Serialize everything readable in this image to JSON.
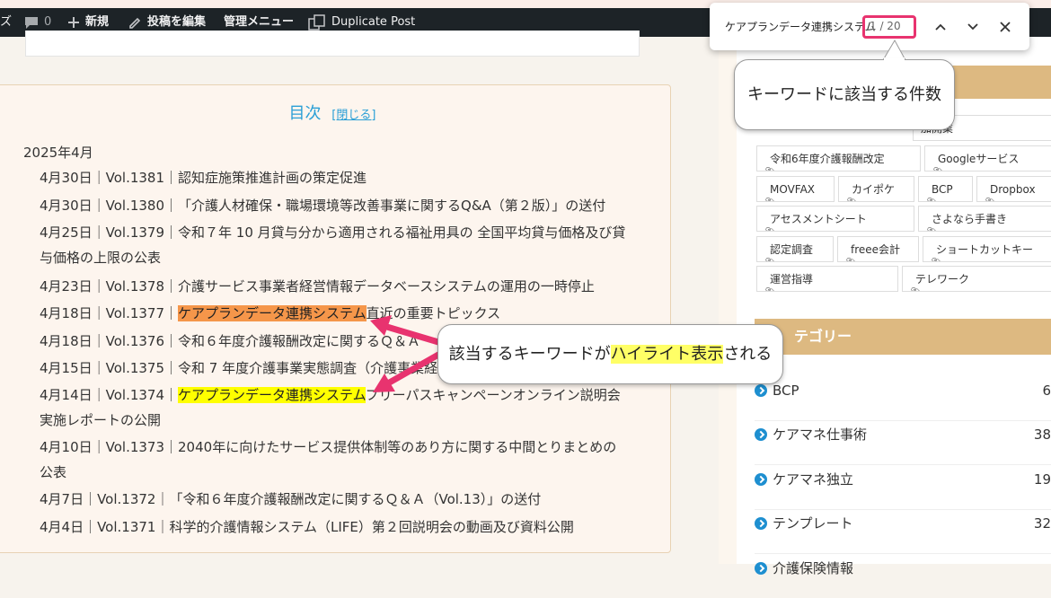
{
  "adminbar": {
    "partial_left": "ズ",
    "comments_count": "0",
    "new_label": "新規",
    "edit_label": "投稿を編集",
    "admin_menu_label": "管理メニュー",
    "duplicate_label": "Duplicate Post"
  },
  "find": {
    "query": "ケアプランデータ連携システム",
    "count": "1 / 20"
  },
  "callouts": {
    "count_note": "キーワードに該当する件数",
    "highlight_note_pre": "該当するキーワードが",
    "highlight_note_hl": "ハイライト表示",
    "highlight_note_post": "される"
  },
  "toc": {
    "title": "目次",
    "close_label": "[閉じる]",
    "month": "2025年4月",
    "items": [
      {
        "text": "4月30日｜Vol.1381｜認知症施策推進計画の策定促進"
      },
      {
        "text": "4月30日｜Vol.1380｜「介護人材確保・職場環境等改善事業に関するQ&A（第２版）」の送付"
      },
      {
        "line1": "4月25日｜Vol.1379｜令和７年 10 月貸与分から適用される福祉用具の 全国平均貸与価格及び貸",
        "line2": "与価格の上限の公表"
      },
      {
        "text": "4月23日｜Vol.1378｜介護サービス事業者経営情報データベースシステムの運用の一時停止"
      },
      {
        "pre": "4月18日｜Vol.1377｜",
        "hl": "ケアプランデータ連携システム",
        "post": "直近の重要トピックス"
      },
      {
        "text": "4月18日｜Vol.1376｜令和６年度介護報酬改定に関するＱ＆Ａ"
      },
      {
        "text": "4月15日｜Vol.1375｜令和 7 年度介護事業実態調査（介護事業経"
      },
      {
        "pre": "4月14日｜Vol.1374｜",
        "hl": "ケアプランデータ連携システム",
        "post": "フリーパスキャンペーンオンライン説明会",
        "line2": "実施レポートの公開"
      },
      {
        "line1": "4月10日｜Vol.1373｜2040年に向けたサービス提供体制等のあり方に関する中間とりまとめの",
        "line2": "公表"
      },
      {
        "text": "4月7日｜Vol.1372｜「令和６年度介護報酬改定に関するＱ＆Ａ（Vol.13）」の送付"
      },
      {
        "text": "4月4日｜Vol.1371｜科学的介護情報システム（LIFE）第２回説明会の動画及び資料公開"
      }
    ]
  },
  "sidebar": {
    "tags": [
      "加開業",
      "令和6年度介護報酬改定",
      "Googleサービス",
      "MOVFAX",
      "カイポケ",
      "BCP",
      "Dropbox",
      "アセスメントシート",
      "さよなら手書き",
      "認定調査",
      "freee会計",
      "ショートカットキー",
      "運営指導",
      "テレワーク"
    ],
    "category_heading": "テゴリー",
    "categories": [
      {
        "name": "BCP",
        "count": "6"
      },
      {
        "name": "ケアマネ仕事術",
        "count": "38"
      },
      {
        "name": "ケアマネ独立",
        "count": "19"
      },
      {
        "name": "テンプレート",
        "count": "32"
      },
      {
        "name": "介護保険情報",
        "count": ""
      }
    ]
  },
  "colors": {
    "adminbar_bg": "#1d2327",
    "current_match": "#f5964a",
    "other_match": "#ffff00",
    "accent_pink": "#e8336f",
    "toc_link": "#2a9fd6",
    "sidebar_heading": "#ddb981"
  }
}
